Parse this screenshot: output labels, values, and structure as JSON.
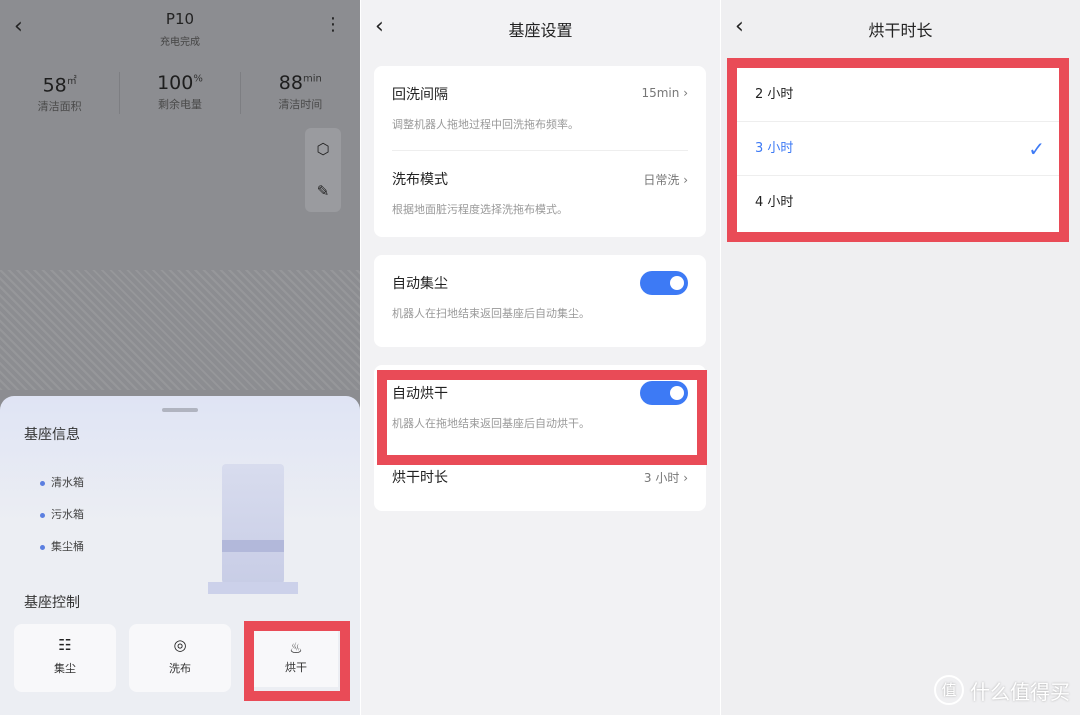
{
  "panel1": {
    "title": "P10",
    "status": "充电完成",
    "stats": [
      {
        "value": "58",
        "unit": "㎡",
        "label": "清洁面积"
      },
      {
        "value": "100",
        "unit": "%",
        "label": "剩余电量"
      },
      {
        "value": "88",
        "unit": "min",
        "label": "清洁时间"
      }
    ],
    "sheet": {
      "info_title": "基座信息",
      "info_items": [
        "清水箱",
        "污水箱",
        "集尘桶"
      ],
      "control_title": "基座控制",
      "controls": [
        {
          "label": "集尘",
          "icon": "dust-bin-icon"
        },
        {
          "label": "洗布",
          "icon": "wash-icon"
        },
        {
          "label": "烘干",
          "icon": "heat-icon"
        }
      ]
    }
  },
  "panel2": {
    "title": "基座设置",
    "items": [
      {
        "title": "回洗间隔",
        "value": "15min",
        "desc": "调整机器人拖地过程中回洗拖布频率。"
      },
      {
        "title": "洗布模式",
        "value": "日常洗",
        "desc": "根据地面脏污程度选择洗拖布模式。"
      },
      {
        "title": "自动集尘",
        "toggle": true,
        "desc": "机器人在扫地结束返回基座后自动集尘。"
      },
      {
        "title": "自动烘干",
        "toggle": true,
        "desc": "机器人在拖地结束返回基座后自动烘干。"
      },
      {
        "title": "烘干时长",
        "value": "3 小时"
      }
    ]
  },
  "panel3": {
    "title": "烘干时长",
    "options": [
      "2 小时",
      "3 小时",
      "4 小时"
    ],
    "selected": "3 小时"
  },
  "watermark": {
    "badge": "值",
    "text": "什么值得买"
  },
  "colors": {
    "accent": "#3d7af5",
    "highlight": "#e94b57"
  }
}
